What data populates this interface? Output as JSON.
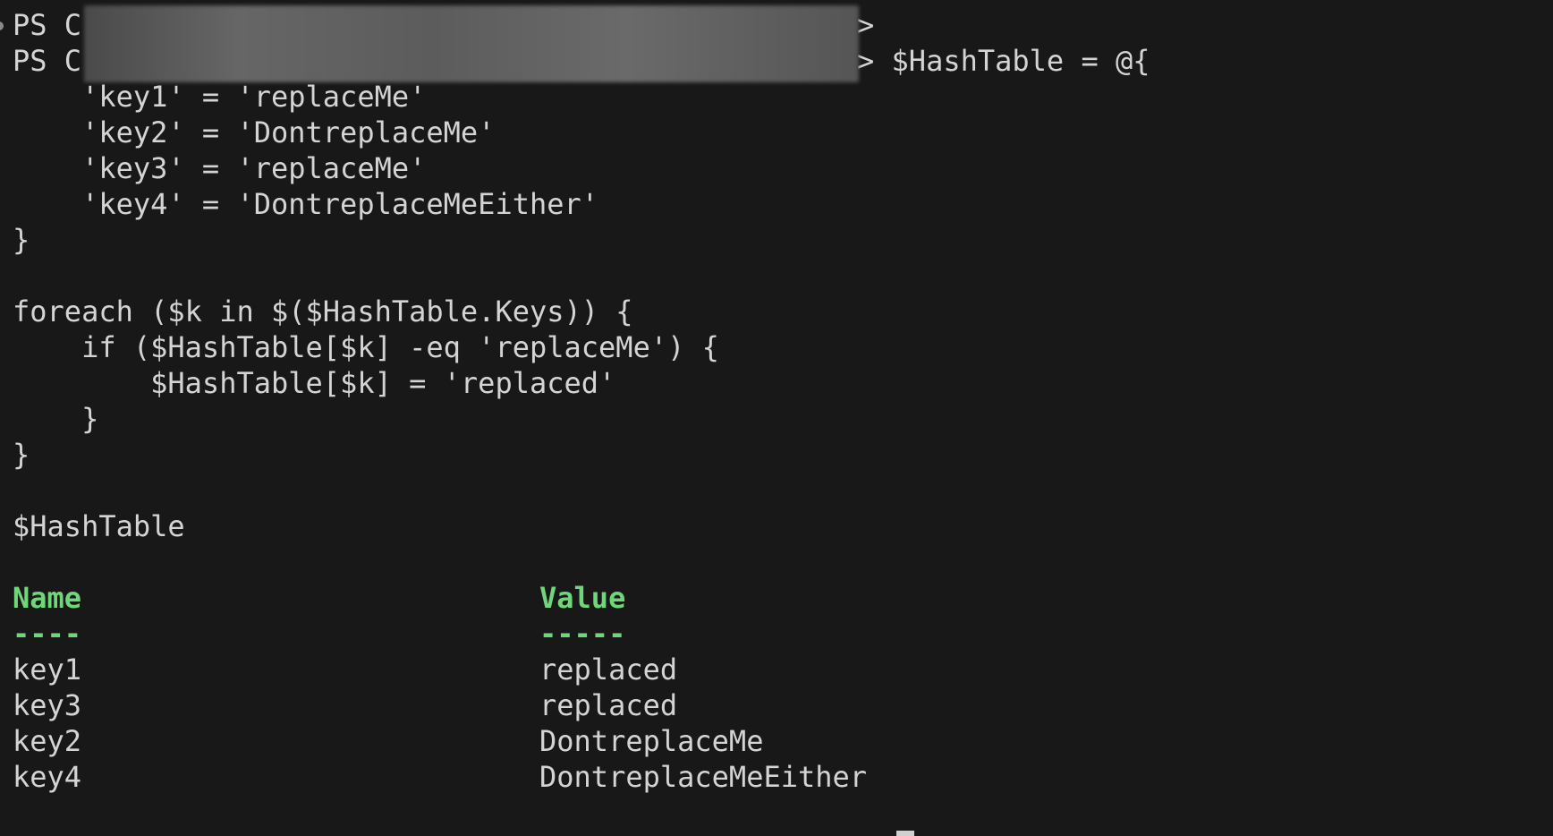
{
  "terminal": {
    "prompt_line_1": "PS C",
    "prompt_line_1_end": ">",
    "prompt_line_2": "PS C",
    "prompt_line_2_end": "> $HashTable = @{",
    "code_lines": [
      "    'key1' = 'replaceMe'",
      "    'key2' = 'DontreplaceMe'",
      "    'key3' = 'replaceMe'",
      "    'key4' = 'DontreplaceMeEither'",
      "}",
      "",
      "foreach ($k in $($HashTable.Keys)) {",
      "    if ($HashTable[$k] -eq 'replaceMe') {",
      "        $HashTable[$k] = 'replaced'",
      "    }",
      "}",
      "",
      "$HashTable"
    ],
    "table": {
      "headers": {
        "name": "Name",
        "value": "Value"
      },
      "underlines": {
        "name": "----",
        "value": "-----"
      },
      "rows": [
        {
          "name": "key1",
          "value": "replaced"
        },
        {
          "name": "key3",
          "value": "replaced"
        },
        {
          "name": "key2",
          "value": "DontreplaceMe"
        },
        {
          "name": "key4",
          "value": "DontreplaceMeEither"
        }
      ]
    },
    "colors": {
      "background": "#181818",
      "text": "#d4d4d4",
      "header": "#6fd67a"
    }
  }
}
